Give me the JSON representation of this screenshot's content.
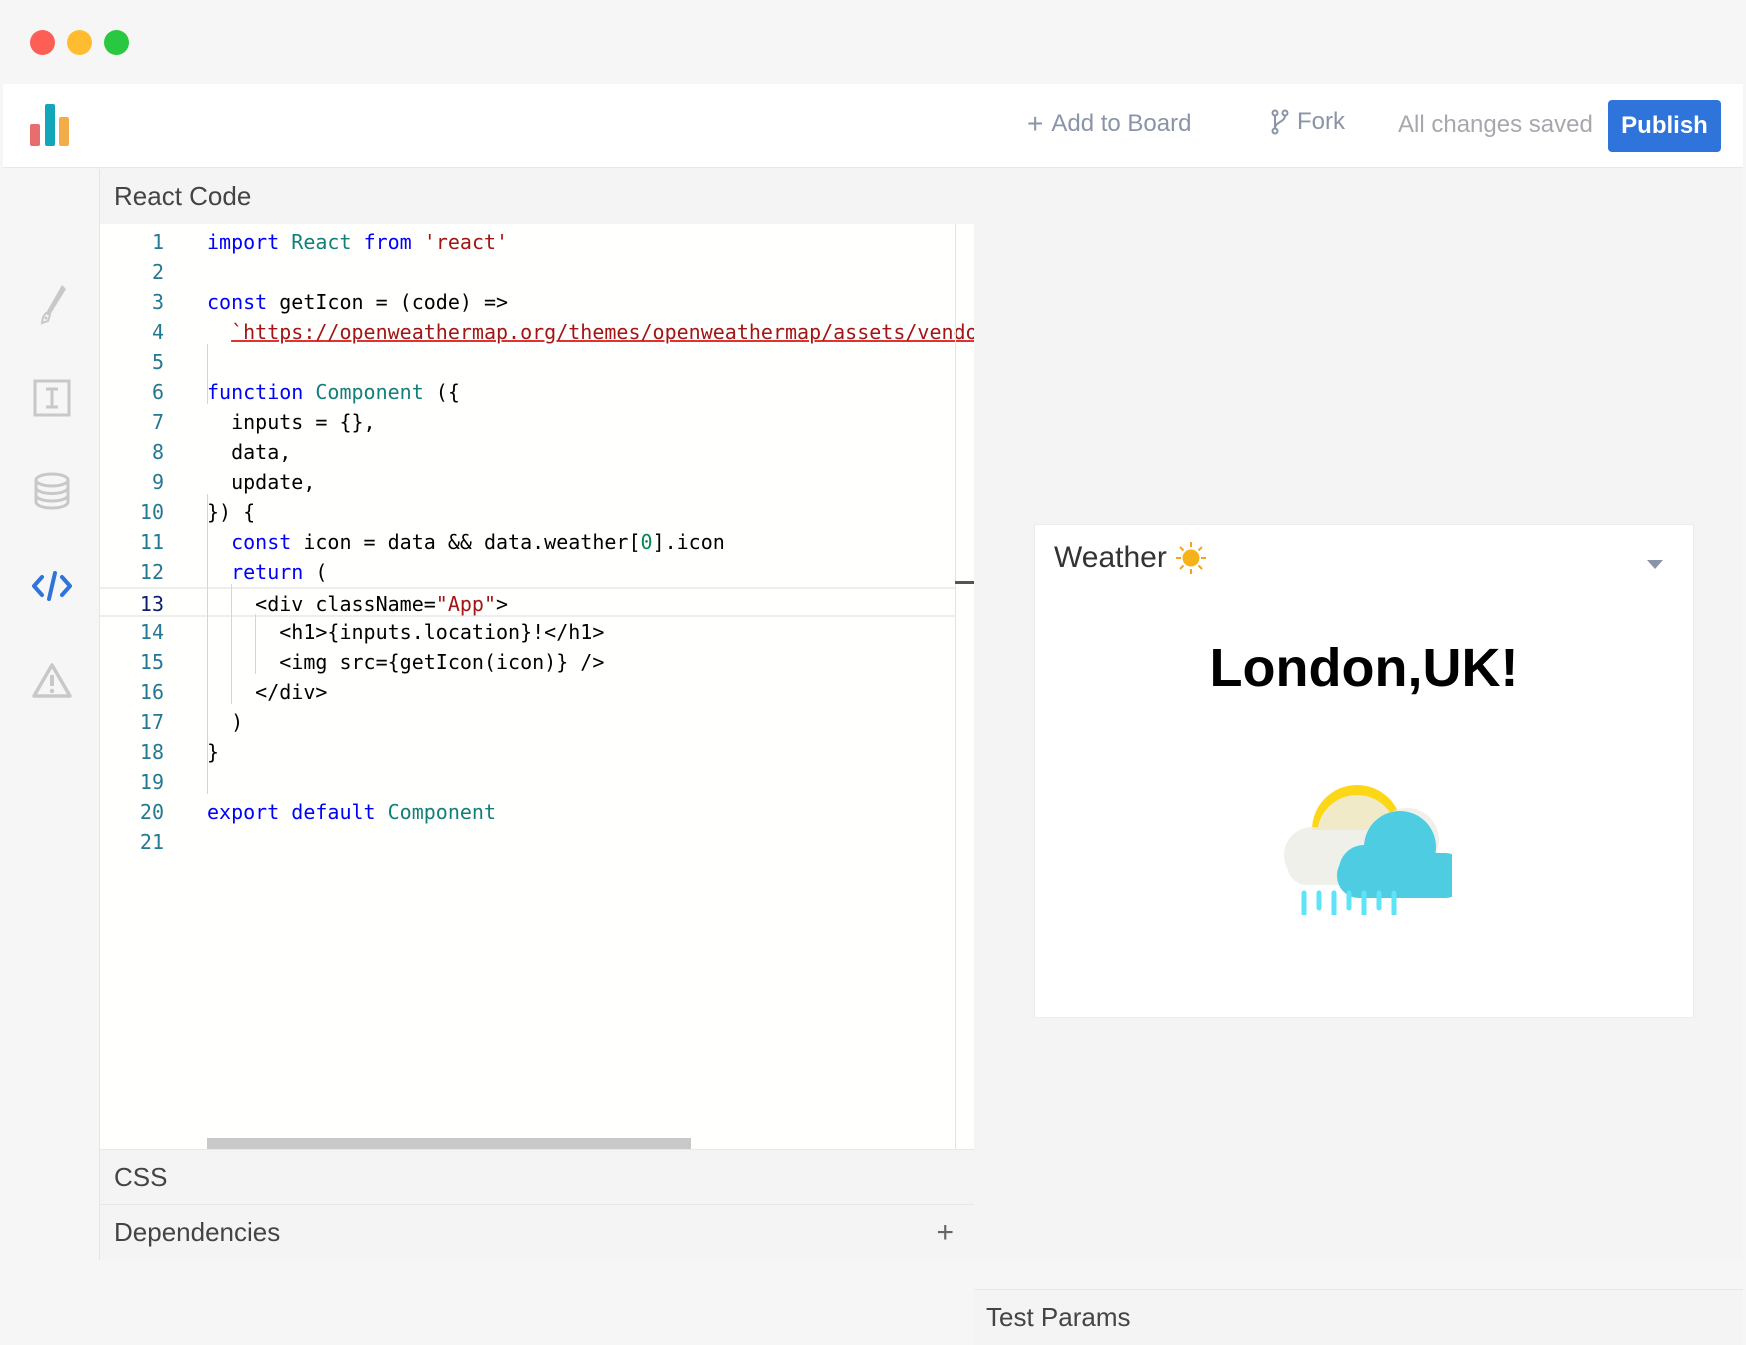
{
  "window": {
    "traffic_lights": [
      "#fd5f57",
      "#febc2e",
      "#28c840"
    ]
  },
  "header": {
    "logo_colors": [
      "#e86d6d",
      "#12a7b8",
      "#f2ac4a"
    ],
    "add_to_board": "Add to Board",
    "add_icon": "plus-icon",
    "fork": "Fork",
    "fork_icon": "git-branch-icon",
    "status": "All changes saved",
    "publish": "Publish",
    "accent": "#2f74da"
  },
  "sidebar": {
    "items": [
      {
        "icon": "pen-icon",
        "active": false
      },
      {
        "icon": "text-input-icon",
        "active": false
      },
      {
        "icon": "database-icon",
        "active": false
      },
      {
        "icon": "code-icon",
        "active": true
      },
      {
        "icon": "warning-icon",
        "active": false
      }
    ]
  },
  "editor": {
    "title": "React Code",
    "active_line": 13,
    "lines": [
      [
        [
          "import",
          "kw"
        ],
        [
          " ",
          ""
        ],
        [
          "React",
          "ty"
        ],
        [
          " ",
          ""
        ],
        [
          "from",
          "kw"
        ],
        [
          " ",
          ""
        ],
        [
          "'react'",
          "st"
        ]
      ],
      [],
      [
        [
          "const",
          "kw"
        ],
        [
          " getIcon = (code) =>",
          ""
        ]
      ],
      [
        [
          "  ",
          ""
        ],
        [
          "`https://openweathermap.org/themes/openweathermap/assets/vendo",
          "url"
        ]
      ],
      [],
      [
        [
          "function",
          "kw"
        ],
        [
          " ",
          ""
        ],
        [
          "Component",
          "ty"
        ],
        [
          " ({",
          ""
        ]
      ],
      [
        [
          "  inputs = {},",
          ""
        ]
      ],
      [
        [
          "  data,",
          ""
        ]
      ],
      [
        [
          "  update,",
          ""
        ]
      ],
      [
        [
          "}) {",
          ""
        ]
      ],
      [
        [
          "  ",
          ""
        ],
        [
          "const",
          "kw"
        ],
        [
          " icon = data && data.weather[",
          ""
        ],
        [
          "0",
          "nu"
        ],
        [
          "].icon",
          ""
        ]
      ],
      [
        [
          "  ",
          ""
        ],
        [
          "return",
          "kw"
        ],
        [
          " (",
          ""
        ]
      ],
      [
        [
          "    <div className=",
          ""
        ],
        [
          "\"App\"",
          "st"
        ],
        [
          ">",
          ""
        ]
      ],
      [
        [
          "      <h1>{inputs.location}!</h1>",
          ""
        ]
      ],
      [
        [
          "      <img src={getIcon(icon)} />",
          ""
        ]
      ],
      [
        [
          "    </div>",
          ""
        ]
      ],
      [
        [
          "  )",
          ""
        ]
      ],
      [
        [
          "}",
          ""
        ]
      ],
      [],
      [
        [
          "export",
          "kw"
        ],
        [
          " ",
          ""
        ],
        [
          "default",
          "kw"
        ],
        [
          " ",
          ""
        ],
        [
          "Component",
          "ty"
        ]
      ],
      []
    ]
  },
  "css_panel": {
    "title": "CSS"
  },
  "dependencies": {
    "title": "Dependencies",
    "add_icon": "plus-icon"
  },
  "preview": {
    "card_title": "Weather",
    "card_emoji": "☀️",
    "heading": "London,UK!",
    "image_icon": "cloud-sun-rain-icon"
  },
  "test_params": {
    "title": "Test Params"
  }
}
